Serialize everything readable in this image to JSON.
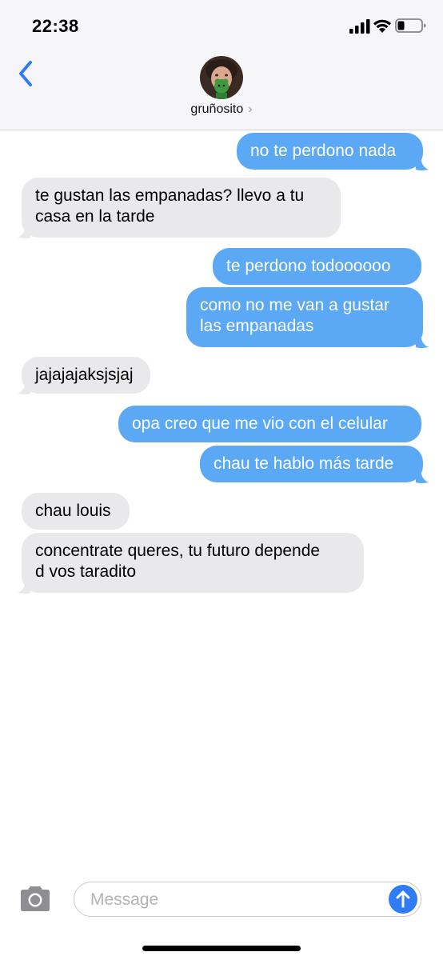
{
  "status_bar": {
    "time": "22:38",
    "icons": [
      "cellular-signal-icon",
      "wifi-icon",
      "battery-icon"
    ]
  },
  "header": {
    "back_icon": "chevron-left-icon",
    "contact_name": "gruñosito",
    "contact_chevron": "›"
  },
  "messages": [
    {
      "direction": "sent",
      "text": "no te perdono nada"
    },
    {
      "direction": "received",
      "text_lines": [
        "te gustan las empanadas? llevo a tu",
        "casa en la tarde"
      ]
    },
    {
      "direction": "sent",
      "text": "te perdono todoooooo"
    },
    {
      "direction": "sent",
      "text_lines": [
        "como no me van a gustar",
        "las empanadas"
      ]
    },
    {
      "direction": "received",
      "text": "jajajajaksjsjaj"
    },
    {
      "direction": "sent",
      "text": "opa creo que me vio con el celular"
    },
    {
      "direction": "sent",
      "text": "chau te hablo más tarde"
    },
    {
      "direction": "received",
      "text": "chau louis"
    },
    {
      "direction": "received",
      "text_lines": [
        "concentrate queres, tu futuro depende",
        "d vos taradito"
      ]
    }
  ],
  "input_bar": {
    "camera_icon": "camera-icon",
    "placeholder": "Message",
    "value": "",
    "send_icon": "arrow-up-icon"
  },
  "colors": {
    "sent_bubble": "#5ba9f4",
    "received_bubble": "#e9e9eb",
    "accent": "#2f7cf6"
  }
}
